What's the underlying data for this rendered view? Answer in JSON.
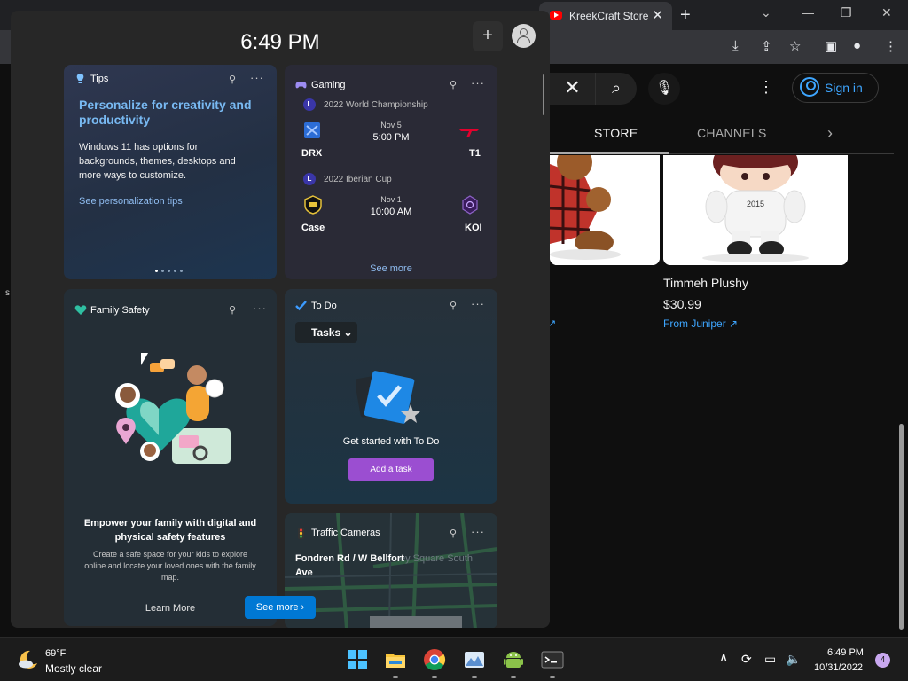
{
  "browser": {
    "tab_title": "KreekCraft Store",
    "tab_close": "✕",
    "new_tab": "+",
    "window_controls": [
      "⌄",
      "—",
      "❐",
      "✕"
    ],
    "toolbar_icons": [
      "⤓",
      "⇪",
      "☆",
      "▣",
      "●",
      "⋮"
    ]
  },
  "youtube": {
    "search_clear": "✕",
    "search_icon": "⌕",
    "mic_icon": "🎙",
    "more_icon": "⋮",
    "sign_in": "Sign in",
    "tabs": {
      "store": "STORE",
      "channels": "CHANNELS",
      "next": "›"
    },
    "product": {
      "name": "Timmeh Plushy",
      "price": "$30.99",
      "from": "From Juniper ↗"
    },
    "side_letter": "s"
  },
  "widgets": {
    "time": "6:49 PM",
    "add_label": "+",
    "tips": {
      "title": "Tips",
      "headline": "Personalize for creativity and productivity",
      "body": "Windows 11 has options for backgrounds, themes, desktops and more ways to customize.",
      "link": "See personalization tips"
    },
    "gaming": {
      "title": "Gaming",
      "matches": [
        {
          "league": "2022 World Championship",
          "date": "Nov 5",
          "time": "5:00 PM",
          "team1": "DRX",
          "team2": "T1"
        },
        {
          "league": "2022 Iberian Cup",
          "date": "Nov 1",
          "time": "10:00 AM",
          "team1": "Case",
          "team2": "KOI"
        }
      ],
      "see_more": "See more"
    },
    "family": {
      "title": "Family Safety",
      "headline": "Empower your family with digital and physical safety features",
      "body": "Create a safe space for your kids to explore online and locate your loved ones with the family map.",
      "learn_more": "Learn More"
    },
    "todo": {
      "title": "To Do",
      "tasks_label": "Tasks",
      "get_started": "Get started with To Do",
      "add_task": "Add a task"
    },
    "traffic": {
      "title": "Traffic Cameras",
      "road": "Fondren Rd / W Bellfort Ave",
      "ghost": "ey Square South"
    },
    "see_more_button": "See more ›",
    "pin_icon": "⚲",
    "more_dots": "···"
  },
  "taskbar": {
    "temp": "69°F",
    "condition": "Mostly clear",
    "tray_chevron": "∧",
    "clock_time": "6:49 PM",
    "clock_date": "10/31/2022",
    "notifications": "4"
  },
  "colors": {
    "accent_blue": "#0078d4",
    "youtube_red": "#ff0000",
    "todo_purple": "#9b4ed1",
    "tips_link": "#78b9f2"
  }
}
